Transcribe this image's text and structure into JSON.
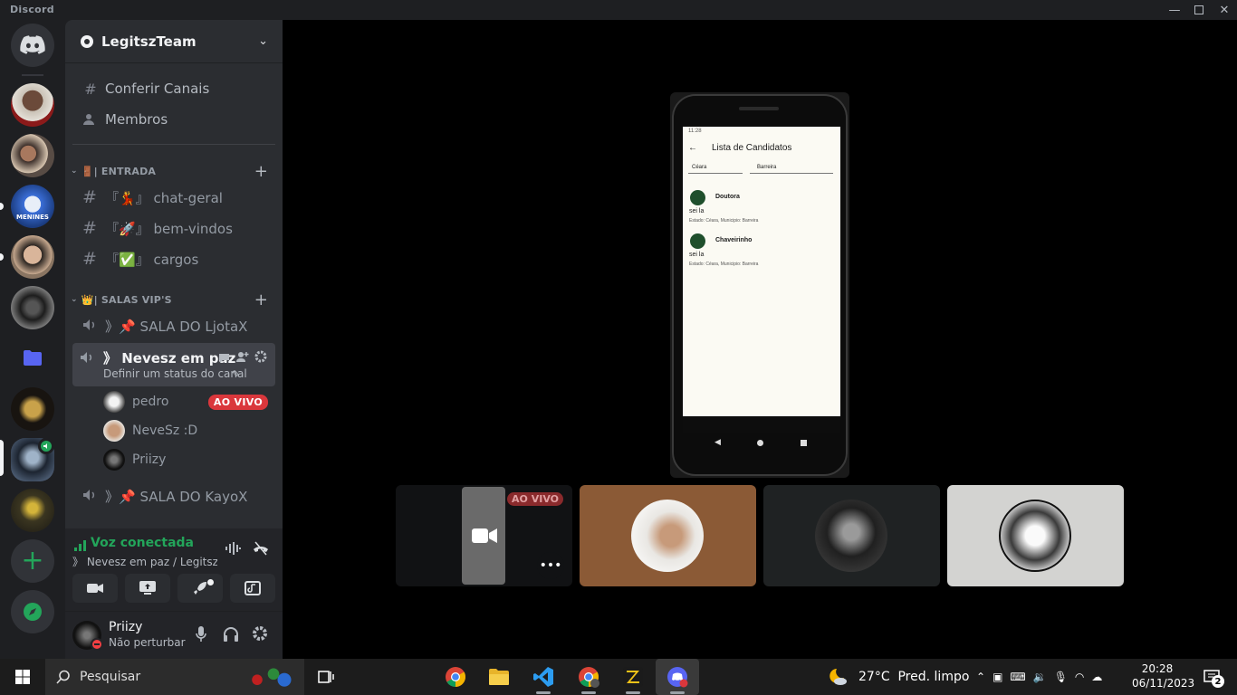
{
  "window": {
    "title": "Discord"
  },
  "guild": {
    "name": "LegitszTeam"
  },
  "nav": {
    "browse": "Conferir Canais",
    "members": "Membros"
  },
  "categories": [
    {
      "label": "🚪| ENTRADA"
    },
    {
      "label": "👑| SALAS VIP'S"
    }
  ],
  "text_channels": [
    {
      "label": "『💃』 chat-geral"
    },
    {
      "label": "『🚀』 bem-vindos"
    },
    {
      "label": "『✅』 cargos"
    }
  ],
  "voice_channels": [
    {
      "label": "》📌 SALA DO LjotaX"
    },
    {
      "label": "》 Nevesz em paz",
      "status": "Definir um status do canal"
    },
    {
      "label": "》📌 SALA DO KayoX"
    }
  ],
  "voice_users": [
    {
      "name": "pedro",
      "badge": "AO VIVO"
    },
    {
      "name": "NeveSz :D"
    },
    {
      "name": "Priizy"
    }
  ],
  "voice_panel": {
    "status": "Voz conectada",
    "location": "》 Nevesz em paz / LegitszT..."
  },
  "user": {
    "name": "Priizy",
    "status": "Não perturbar"
  },
  "stream": {
    "screen_title": "Lista de Candidatos",
    "time": "11:28",
    "state": "Céara",
    "city": "Barreira",
    "candidates": [
      {
        "name": "Doutora",
        "desc": "sei la",
        "detail": "Estado: Céara, Municipio: Barreira"
      },
      {
        "name": "Chaveirinho",
        "desc": "sei la",
        "detail": "Estado: Céara, Municipio: Barreira"
      }
    ]
  },
  "tiles": {
    "live_badge": "AO VIVO"
  },
  "taskbar": {
    "search_placeholder": "Pesquisar",
    "weather": "27°C  Pred. limpo",
    "time": "20:28",
    "date": "06/11/2023",
    "notifications": "2"
  },
  "colors": {
    "accent": "#5865f2",
    "connected": "#23a55a",
    "live": "#da373c",
    "dnd": "#f23f43"
  }
}
